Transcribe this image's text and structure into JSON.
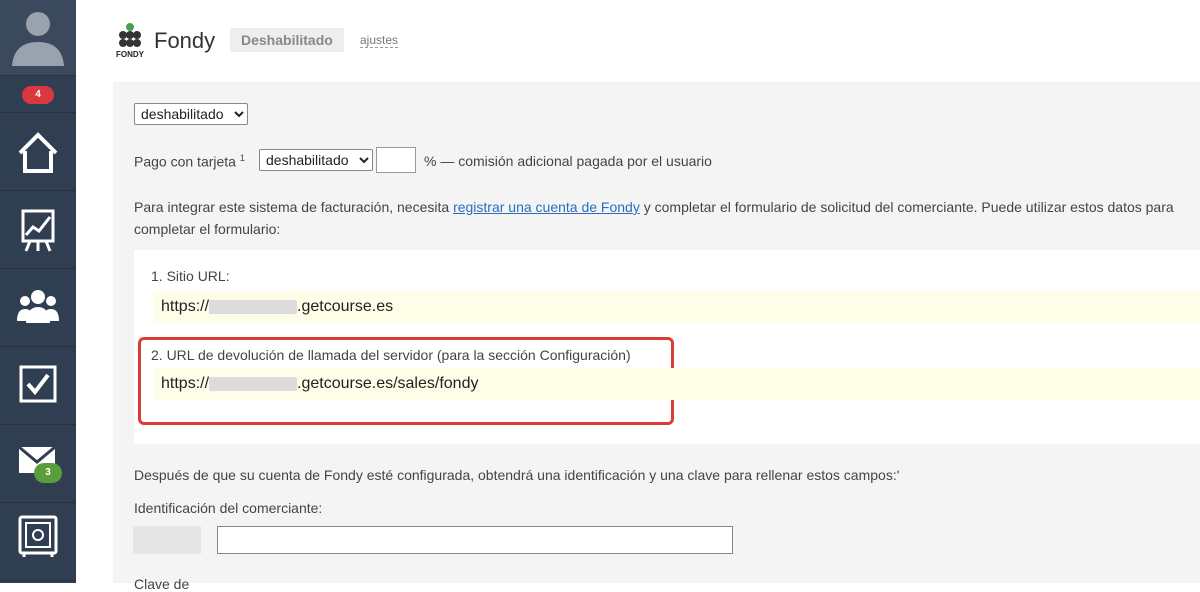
{
  "sidebar": {
    "notifications_badge": "4",
    "mail_badge": "3",
    "icons": [
      "avatar-icon",
      "home-icon",
      "chart-icon",
      "users-icon",
      "checkbox-icon",
      "mail-icon",
      "safe-icon"
    ]
  },
  "header": {
    "logo_text": "FONDY",
    "title": "Fondy",
    "status": "Deshabilitado",
    "settings_link": "ajustes"
  },
  "form": {
    "status_select": "deshabilitado",
    "card_label": "Pago con tarjeta",
    "card_footnote": "1",
    "card_select": "deshabilitado",
    "card_percent_value": "",
    "card_percent_text": "% — comisión adicional pagada por el usuario",
    "intro_before_link": "Para integrar este sistema de facturación, necesita ",
    "intro_link": "registrar una cuenta de Fondy",
    "intro_after_link": " y completar el formulario de solicitud del comerciante. Puede utilizar estos datos para completar el formulario:",
    "site_url_label": "1. Sitio URL:",
    "site_url_prefix": "https://",
    "site_url_suffix": ".getcourse.es",
    "callback_label": "2. URL de devolución de llamada del servidor (para la sección Configuración)",
    "callback_prefix": "https://",
    "callback_suffix": ".getcourse.es/sales/fondy",
    "after_text": "Después de que su cuenta de Fondy esté configurada, obtendrá una identificación y una clave para rellenar estos campos:'",
    "merchant_label": "Identificación del comerciante:",
    "merchant_value": "",
    "key_label": "Clave de"
  },
  "colors": {
    "sidebar": "#2f3e50",
    "badge_red": "#d9393e",
    "badge_green": "#5a9e3a",
    "link": "#2a6ebb",
    "highlight": "#d93d35",
    "url_background": "#fdfde8"
  }
}
